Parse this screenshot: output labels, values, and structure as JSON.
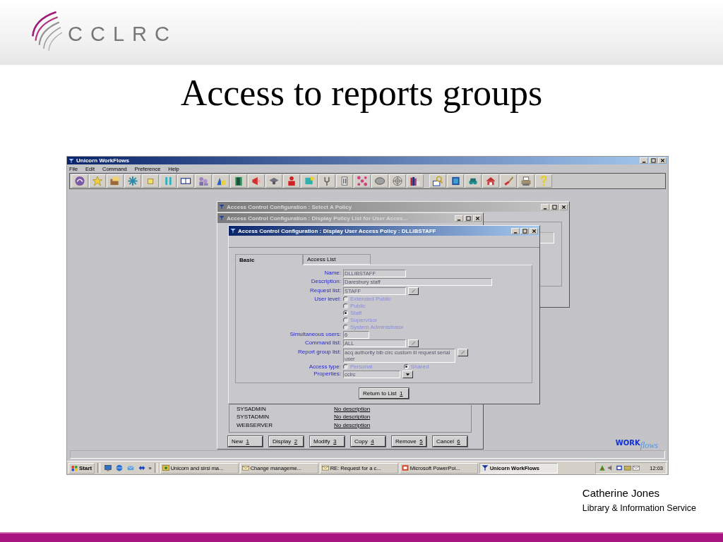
{
  "slide": {
    "logo_text": "CCLRC",
    "title": "Access to reports groups",
    "author": "Catherine Jones",
    "department": "Library & Information Service"
  },
  "app": {
    "title": "Unicorn WorkFlows",
    "menu": [
      "File",
      "Edit",
      "Command",
      "Preference",
      "Help"
    ],
    "policy_select": {
      "title": "Access Control Configuration : Select A Policy",
      "active": false
    },
    "policy_list": {
      "title": "Access Control Configuration : Display Policy List for User Acces...",
      "active": false,
      "rows": [
        {
          "name": "SYSADMIN",
          "description": "No description"
        },
        {
          "name": "SYSTADMIN",
          "description": "No description"
        },
        {
          "name": "WEBSERVER",
          "description": "No description"
        }
      ],
      "buttons": [
        {
          "label": "New",
          "key": "1"
        },
        {
          "label": "Display",
          "key": "2"
        },
        {
          "label": "Modify",
          "key": "3"
        },
        {
          "label": "Copy",
          "key": "4"
        },
        {
          "label": "Remove",
          "key": "5"
        },
        {
          "label": "Cancel",
          "key": "6"
        }
      ]
    },
    "policy_detail": {
      "title": "Access Control Configuration : Display User Access Policy : DLLIBSTAFF",
      "active": true,
      "tabs": [
        {
          "label": "Basic",
          "selected": true
        },
        {
          "label": "Access List",
          "selected": false
        }
      ],
      "fields": [
        {
          "label": "Name:",
          "kind": "text",
          "value": "DLLIBSTAFF"
        },
        {
          "label": "Description:",
          "kind": "text",
          "value": "Daresbury staff"
        },
        {
          "label": "Request list:",
          "kind": "picker",
          "value": "STAFF"
        },
        {
          "label": "User level:",
          "kind": "radio",
          "options": [
            {
              "label": "Extended Public",
              "selected": false
            },
            {
              "label": "Public",
              "selected": false
            },
            {
              "label": "Staff",
              "selected": true
            },
            {
              "label": "Supervisor",
              "selected": false
            },
            {
              "label": "System Administrator",
              "selected": false
            }
          ]
        },
        {
          "label": "Simultaneous users:",
          "kind": "text",
          "value": "6"
        },
        {
          "label": "Command list:",
          "kind": "picker",
          "value": "ALL"
        },
        {
          "label": "Report group list:",
          "kind": "picker",
          "value": "acq authority bib circ custom ill request serial user"
        },
        {
          "label": "Access type:",
          "kind": "radio_row",
          "options": [
            {
              "label": "Personal",
              "selected": false
            },
            {
              "label": "Shared",
              "selected": true
            }
          ]
        },
        {
          "label": "Properties:",
          "kind": "dropdown",
          "value": "cclrc"
        }
      ],
      "button": {
        "label": "Return to List",
        "key": "1"
      }
    },
    "brand": {
      "bold": "WORK",
      "script": "flows"
    },
    "taskbar": {
      "start": "Start",
      "overflow": "»",
      "tasks": [
        {
          "label": "Unicorn and sirsi ma...",
          "selected": false
        },
        {
          "label": "Change manageme...",
          "selected": false
        },
        {
          "label": "RE: Request for a c...",
          "selected": false
        },
        {
          "label": "Microsoft PowerPoi...",
          "selected": false
        },
        {
          "label": "Unicorn WorkFlows",
          "selected": true
        }
      ],
      "clock": "12:03"
    }
  }
}
